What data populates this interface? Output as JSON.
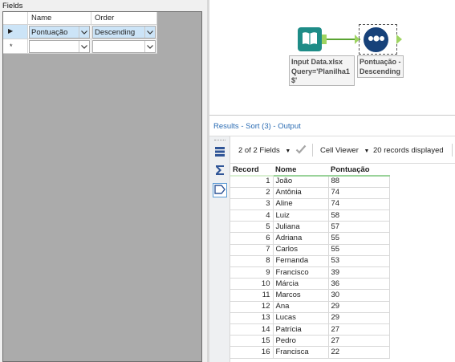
{
  "config": {
    "section_label": "Fields",
    "columns": {
      "name": "Name",
      "order": "Order"
    },
    "rows": [
      {
        "marker": "▶",
        "name": "Pontuação",
        "order": "Descending"
      },
      {
        "marker": "*",
        "name": "",
        "order": ""
      }
    ]
  },
  "canvas": {
    "input_tool": {
      "icon": "book-icon",
      "annotation": "Input Data.xlsx\nQuery='Planilha1\n$'"
    },
    "sort_tool": {
      "icon": "sort-icon",
      "annotation": "Pontuação -\nDescending"
    }
  },
  "results": {
    "title": "Results - Sort (3) - Output",
    "fields_label": "2 of 2 Fields",
    "viewer_label": "Cell Viewer",
    "records_label": "20 records displayed",
    "columns": [
      "Record",
      "Nome",
      "Pontuação"
    ],
    "rows": [
      [
        "1",
        "João",
        "88"
      ],
      [
        "2",
        "Antônia",
        "74"
      ],
      [
        "3",
        "Aline",
        "74"
      ],
      [
        "4",
        "Luiz",
        "58"
      ],
      [
        "5",
        "Juliana",
        "57"
      ],
      [
        "6",
        "Adriana",
        "55"
      ],
      [
        "7",
        "Carlos",
        "55"
      ],
      [
        "8",
        "Fernanda",
        "53"
      ],
      [
        "9",
        "Francisco",
        "39"
      ],
      [
        "10",
        "Márcia",
        "36"
      ],
      [
        "11",
        "Marcos",
        "30"
      ],
      [
        "12",
        "Ana",
        "29"
      ],
      [
        "13",
        "Lucas",
        "29"
      ],
      [
        "14",
        "Patrícia",
        "27"
      ],
      [
        "15",
        "Pedro",
        "27"
      ],
      [
        "16",
        "Francisca",
        "22"
      ]
    ]
  },
  "colors": {
    "input_tool": "#1e8c87",
    "sort_tool": "#17427a",
    "connector": "#5aa332",
    "results_title": "#2b6cb3"
  }
}
